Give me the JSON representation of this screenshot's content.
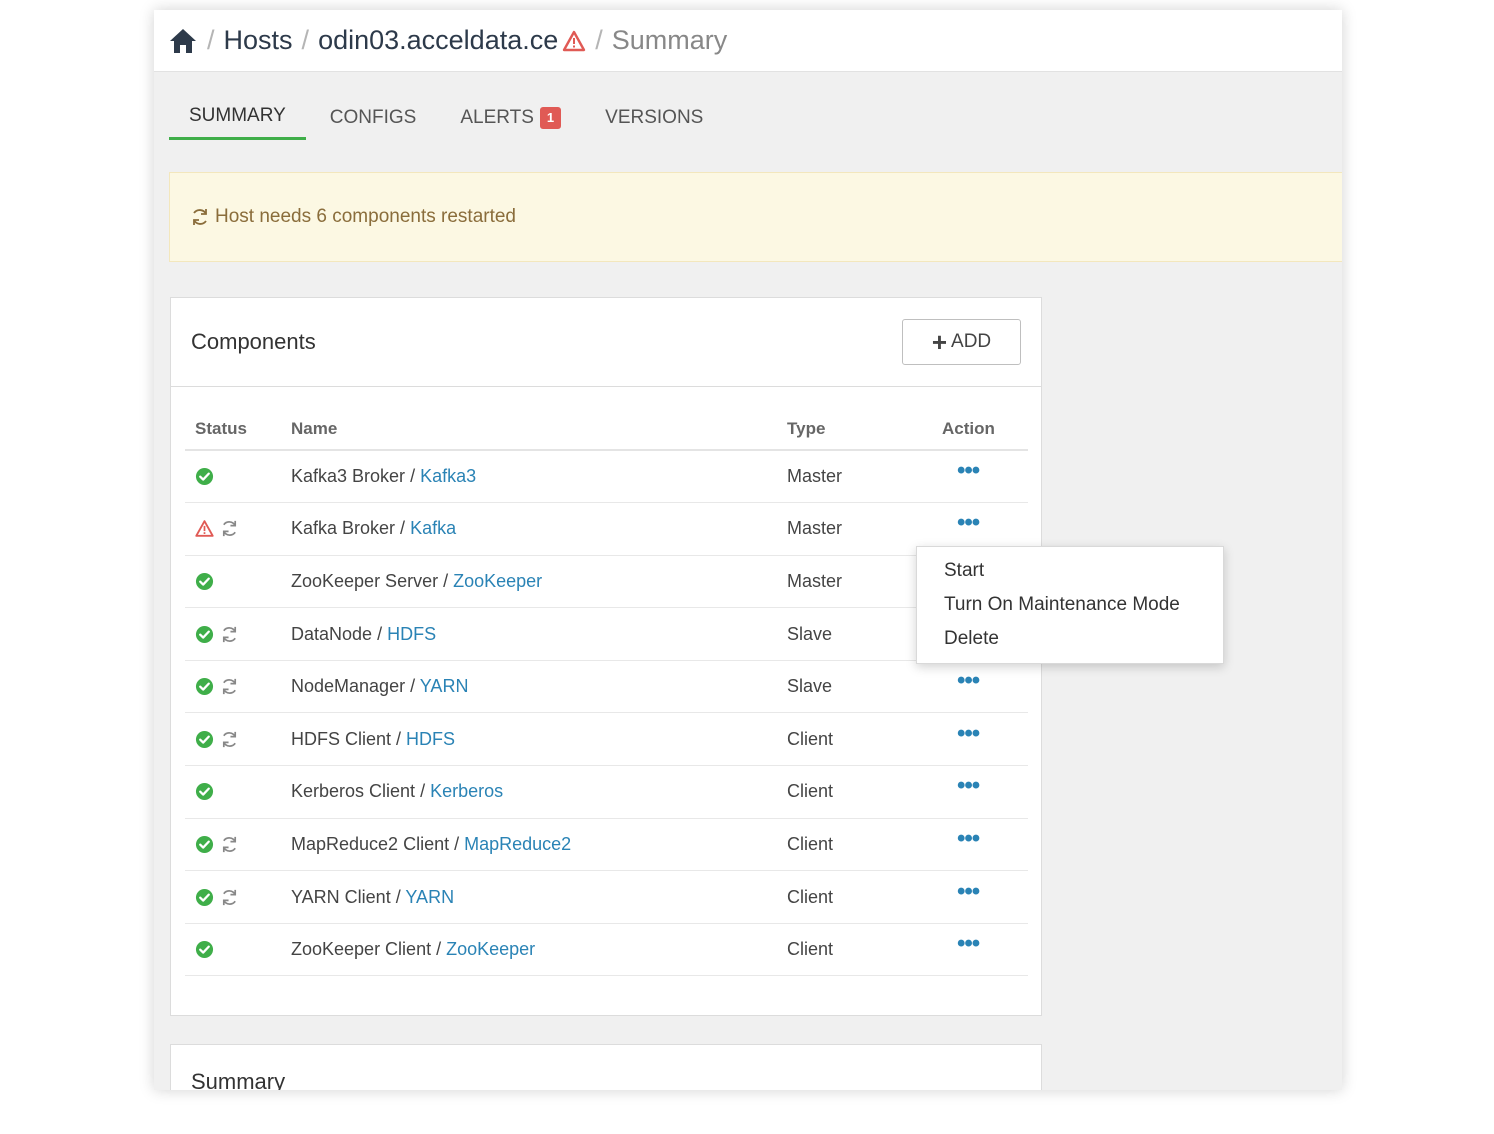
{
  "breadcrumb": {
    "home_icon": "home-icon",
    "hosts": "Hosts",
    "host": "odin03.acceldata.ce",
    "host_alert_icon": "warning-triangle-icon",
    "current": "Summary",
    "separator": "/"
  },
  "tabs": [
    {
      "label": "SUMMARY",
      "active": true
    },
    {
      "label": "CONFIGS",
      "active": false
    },
    {
      "label": "ALERTS",
      "active": false,
      "badge": "1"
    },
    {
      "label": "VERSIONS",
      "active": false
    }
  ],
  "alert": {
    "icon": "refresh-icon",
    "text": "Host needs 6 components restarted"
  },
  "components": {
    "title": "Components",
    "add_button": "ADD",
    "columns": {
      "status": "Status",
      "name": "Name",
      "type": "Type",
      "action": "Action"
    },
    "rows": [
      {
        "component": "Kafka3 Broker",
        "service": "Kafka3",
        "type": "Master",
        "status": "ok",
        "restart": false
      },
      {
        "component": "Kafka Broker",
        "service": "Kafka",
        "type": "Master",
        "status": "alert",
        "restart": true
      },
      {
        "component": "ZooKeeper Server",
        "service": "ZooKeeper",
        "type": "Master",
        "status": "ok",
        "restart": false
      },
      {
        "component": "DataNode",
        "service": "HDFS",
        "type": "Slave",
        "status": "ok",
        "restart": true
      },
      {
        "component": "NodeManager",
        "service": "YARN",
        "type": "Slave",
        "status": "ok",
        "restart": true
      },
      {
        "component": "HDFS Client",
        "service": "HDFS",
        "type": "Client",
        "status": "ok",
        "restart": true
      },
      {
        "component": "Kerberos Client",
        "service": "Kerberos",
        "type": "Client",
        "status": "ok",
        "restart": false
      },
      {
        "component": "MapReduce2 Client",
        "service": "MapReduce2",
        "type": "Client",
        "status": "ok",
        "restart": true
      },
      {
        "component": "YARN Client",
        "service": "YARN",
        "type": "Client",
        "status": "ok",
        "restart": true
      },
      {
        "component": "ZooKeeper Client",
        "service": "ZooKeeper",
        "type": "Client",
        "status": "ok",
        "restart": false
      }
    ],
    "action_label": "•••"
  },
  "action_menu": {
    "items": [
      "Start",
      "Turn On Maintenance Mode",
      "Delete"
    ]
  },
  "summary_panel": {
    "title": "Summary"
  },
  "colors": {
    "ok": "#3fae49",
    "alert": "#e05a55",
    "link": "#2a83b5",
    "active_tab": "#3fae49"
  }
}
